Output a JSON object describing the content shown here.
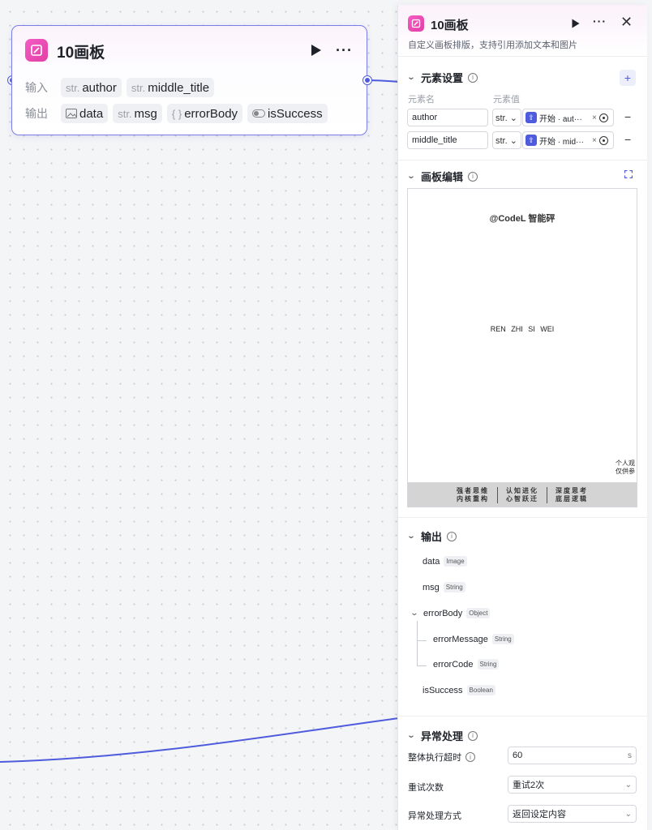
{
  "node": {
    "title": "10画板",
    "input_label": "输入",
    "output_label": "输出",
    "inputs": [
      {
        "type": "str.",
        "name": "author"
      },
      {
        "type": "str.",
        "name": "middle_title"
      }
    ],
    "outputs": [
      {
        "type_icon": "image-icon",
        "name": "data"
      },
      {
        "type": "str.",
        "name": "msg"
      },
      {
        "type": "{ }",
        "name": "errorBody"
      },
      {
        "type_icon": "toggle-icon",
        "name": "isSuccess"
      }
    ]
  },
  "panel": {
    "title": "10画板",
    "description": "自定义画板排版，支持引用添加文本和图片",
    "element_settings": {
      "title": "元素设置",
      "col_name": "元素名",
      "col_value": "元素值",
      "rows": [
        {
          "name": "author",
          "type": "str.",
          "ref": "开始 · aut···"
        },
        {
          "name": "middle_title",
          "type": "str.",
          "ref": "开始 · mid···"
        }
      ]
    },
    "canvas_edit": {
      "title": "画板编辑",
      "brand": "@CodeL 智能砰",
      "middle": "REN ZHI SI WEI",
      "corner_line1": "个人观",
      "corner_line2": "仅供参",
      "footer": [
        {
          "line1": "强者思维",
          "line2": "内核重构"
        },
        {
          "line1": "认知进化",
          "line2": "心智跃迁"
        },
        {
          "line1": "深度思考",
          "line2": "底层逻辑"
        }
      ]
    },
    "output": {
      "title": "输出",
      "items": [
        {
          "name": "data",
          "type": "Image"
        },
        {
          "name": "msg",
          "type": "String"
        },
        {
          "name": "errorBody",
          "type": "Object"
        },
        {
          "name": "errorMessage",
          "type": "String"
        },
        {
          "name": "errorCode",
          "type": "String"
        },
        {
          "name": "isSuccess",
          "type": "Boolean"
        }
      ]
    },
    "exception": {
      "title": "异常处理",
      "timeout_label": "整体执行超时",
      "timeout_value": "60",
      "timeout_unit": "s",
      "retry_label": "重试次数",
      "retry_value": "重试2次",
      "method_label": "异常处理方式",
      "method_value": "返回设定内容"
    }
  },
  "colors": {
    "accent": "#4e5bdd",
    "node_icon": "#e23fa4"
  }
}
